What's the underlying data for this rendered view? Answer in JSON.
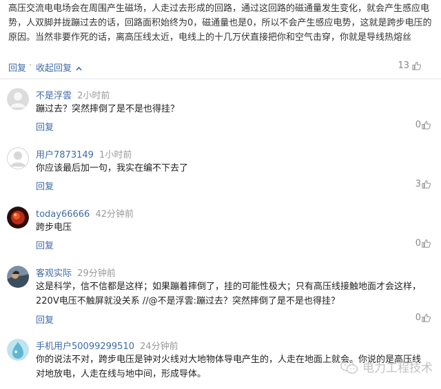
{
  "top_comment": {
    "text": "高压交流电电场会在周围产生磁场，人走过去形成的回路，通过这回路的磁通量发生变化，就会产生感应电势，人双脚并拢蹦过去的话，回路面积始终为0，磁通量也是0，所以不会产生感应电势，这就是跨步电压的原因。当然非要作死的话，离高压线太近，电线上的十几万伏直接把你和空气击穿，你就是导线热熔丝",
    "reply_label": "回复",
    "separator": "·",
    "collapse_label": "收起回复",
    "likes": "13"
  },
  "comments": [
    {
      "username": "不是浮雲",
      "time": "2小时前",
      "text": "蹦过去？突然摔倒了是不是也得挂？",
      "reply_label": "回复",
      "likes": "0"
    },
    {
      "username": "用户7873149",
      "time": "1小时前",
      "text": "你应该最后加一句，我实在编不下去了",
      "reply_label": "回复",
      "likes": "3"
    },
    {
      "username": "today66666",
      "time": "42分钟前",
      "text": "跨步电压",
      "reply_label": "回复",
      "likes": "0"
    },
    {
      "username": "客观实际",
      "time": "29分钟前",
      "text": "这是科学，信不信都是这样；如果蹦着摔倒了，挂的可能性极大；只有高压线接触地面才会这样，220V电压不触屏就没关系 //@不是浮雲:蹦过去？突然摔倒了是不是也得挂？",
      "reply_label": "回复",
      "likes": "0"
    },
    {
      "username": "手机用户50099299510",
      "time": "24分钟前",
      "text": "你的说法不对，跨步电压是钟对火线对大地物体导电产生的，人走在地面上就会。你说的是高压线对地放电，人走在线与地中间，形成导体。"
    }
  ],
  "watermark": {
    "text": "电力工程技术"
  },
  "colors": {
    "link": "#3d6aa8",
    "meta": "#999999",
    "text": "#222222",
    "divider": "#e6e6e6"
  },
  "icons": {
    "like": "thumbs-up-icon",
    "avatar_default": "default-avatar-icon",
    "watermark": "wechat-icon"
  }
}
